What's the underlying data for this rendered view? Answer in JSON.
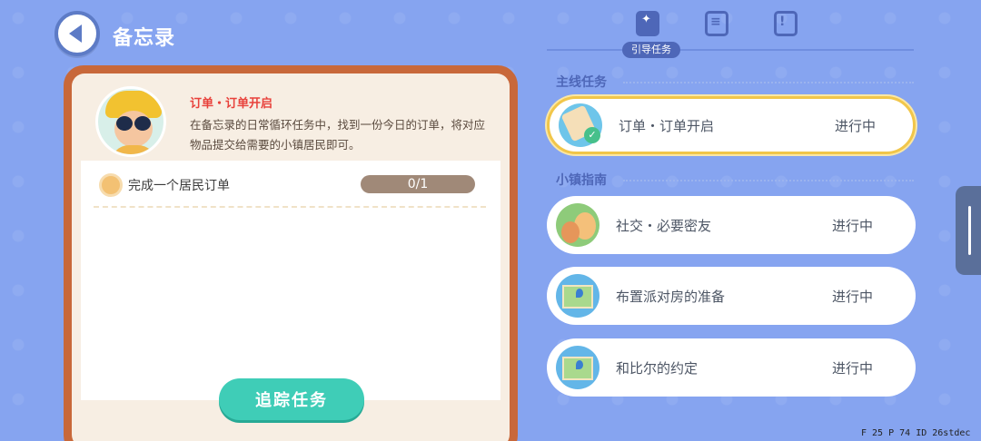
{
  "header": {
    "title": "备忘录",
    "back_icon": "back-arrow-icon"
  },
  "detail": {
    "task_title": "订单・订单开启",
    "task_description": "在备忘录的日常循环任务中，找到一份今日的订单，将对应物品提交给需要的小镇居民即可。",
    "objective": {
      "label": "完成一个居民订单",
      "progress": "0/1",
      "progress_fraction": 0
    },
    "track_button": "追踪任务"
  },
  "tabs": {
    "items": [
      {
        "icon": "book-star-icon",
        "active": true
      },
      {
        "icon": "clipboard-icon",
        "active": false
      },
      {
        "icon": "bookmark-alert-icon",
        "active": false
      }
    ],
    "active_label": "引导任务"
  },
  "sections": {
    "main": {
      "header": "主线任务",
      "quests": [
        {
          "name": "订单・订单开启",
          "status": "进行中",
          "selected": true,
          "icon": "order-icon"
        }
      ]
    },
    "guide": {
      "header": "小镇指南",
      "quests": [
        {
          "name": "社交・必要密友",
          "status": "进行中",
          "icon": "friends-icon"
        },
        {
          "name": "布置派对房的准备",
          "status": "进行中",
          "icon": "map-icon"
        },
        {
          "name": "和比尔的约定",
          "status": "进行中",
          "icon": "map-icon"
        }
      ]
    }
  },
  "debug": "F 25  P 74  ID 26stdec",
  "colors": {
    "background": "#86a4f0",
    "accent": "#4e67b8",
    "highlight": "#f1c64a",
    "track_button": "#3fcdb7",
    "task_title": "#e8413b"
  }
}
